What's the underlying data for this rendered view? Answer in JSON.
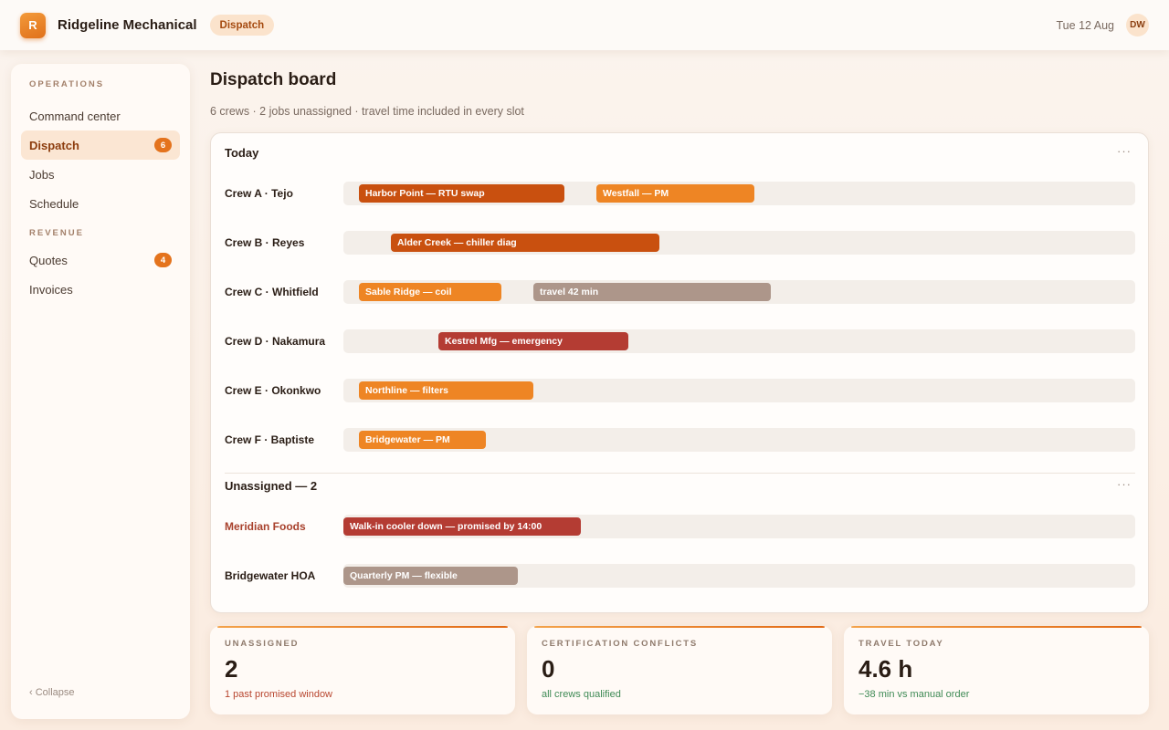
{
  "app": {
    "logo_letter": "R",
    "title": "Ridgeline Mechanical",
    "context_pill": "Dispatch",
    "date": "Tue 12 Aug",
    "user_initials": "DW"
  },
  "sidebar": {
    "sections": [
      {
        "label": "OPERATIONS"
      },
      {
        "label": "REVENUE"
      }
    ],
    "items": [
      {
        "label": "Command center"
      },
      {
        "label": "Dispatch",
        "badge": "6",
        "active": true
      },
      {
        "label": "Jobs"
      },
      {
        "label": "Schedule"
      },
      {
        "label": "Quotes",
        "badge": "4"
      },
      {
        "label": "Invoices"
      }
    ],
    "collapse_label": "‹ Collapse"
  },
  "page": {
    "title": "Dispatch board",
    "subtitle": "6 crews · 2 jobs unassigned · travel time included in every slot"
  },
  "board": {
    "today_heading": "Today",
    "unassigned_heading": "Unassigned — 2",
    "more_glyph": "···",
    "crews": [
      {
        "name": "Crew A · Tejo",
        "jobs": [
          {
            "label": "Harbor Point — RTU swap",
            "color": "#c9500f"
          },
          {
            "label": "Westfall — PM",
            "color": "#ee8524"
          }
        ]
      },
      {
        "name": "Crew B · Reyes",
        "jobs": [
          {
            "label": "Alder Creek — chiller diag",
            "color": "#c9500f"
          }
        ]
      },
      {
        "name": "Crew C · Whitfield",
        "jobs": [
          {
            "label": "Sable Ridge — coil",
            "color": "#ee8524"
          },
          {
            "label": "travel 42 min",
            "color": "#ad968a"
          }
        ]
      },
      {
        "name": "Crew D · Nakamura",
        "jobs": [
          {
            "label": "Kestrel Mfg — emergency",
            "color": "#b43c33"
          }
        ]
      },
      {
        "name": "Crew E · Okonkwo",
        "jobs": [
          {
            "label": "Northline — filters",
            "color": "#ee8524"
          }
        ]
      },
      {
        "name": "Crew F · Baptiste",
        "jobs": [
          {
            "label": "Bridgewater — PM",
            "color": "#ee8524"
          }
        ]
      }
    ],
    "unassigned": [
      {
        "name": "Meridian Foods",
        "jobs": [
          {
            "label": "Walk-in cooler down — promised by 14:00",
            "color": "#b43c33"
          }
        ]
      },
      {
        "name": "Bridgewater HOA",
        "jobs": [
          {
            "label": "Quarterly PM — flexible",
            "color": "#ad968a"
          }
        ]
      }
    ]
  },
  "stats": [
    {
      "label": "UNASSIGNED",
      "value": "2",
      "note": "1 past promised window"
    },
    {
      "label": "CERTIFICATION CONFLICTS",
      "value": "0",
      "note": "all crews qualified"
    },
    {
      "label": "TRAVEL TODAY",
      "value": "4.6 h",
      "note": "−38 min vs manual order"
    }
  ]
}
